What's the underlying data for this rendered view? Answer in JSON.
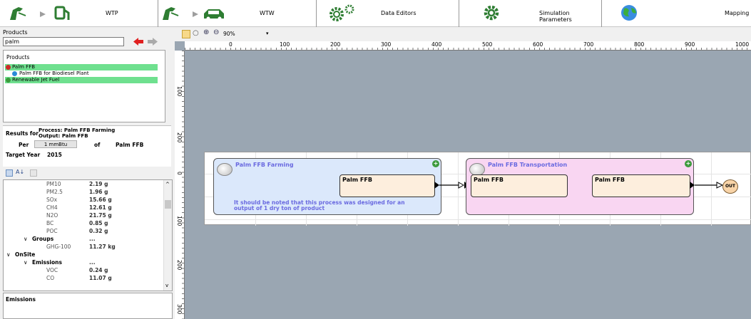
{
  "toolbar": {
    "items": [
      {
        "label": "WTP",
        "icon": "pump-to-fuel-icon"
      },
      {
        "label": "WTW",
        "icon": "pump-to-car-icon"
      },
      {
        "label": "Data Editors",
        "icon": "gears-icon"
      },
      {
        "label": "Simulation Parameters",
        "icon": "gear-icon"
      },
      {
        "label": "Mapping",
        "icon": "globe-icon"
      }
    ]
  },
  "products_panel": {
    "header": "Products",
    "search_value": "palm",
    "tree_header": "Products",
    "tree": [
      {
        "label": "Palm FFB",
        "highlight": true
      },
      {
        "label": "Palm FFB for Biodiesel Plant",
        "highlight": false
      },
      {
        "label": "Renewable Jet Fuel",
        "highlight": true
      }
    ]
  },
  "results": {
    "results_for_label": "Results for",
    "process": "Process: Palm FFB Farming",
    "output": "Output: Palm FFB",
    "per_label": "Per",
    "per_value": "1 mmBtu",
    "of_label": "of",
    "of_value": "Palm FFB",
    "target_year_label": "Target Year",
    "target_year": "2015",
    "rows": [
      {
        "name": "PM10",
        "value": "2.19 g",
        "level": 2
      },
      {
        "name": "PM2.5",
        "value": "1.96 g",
        "level": 2
      },
      {
        "name": "SOx",
        "value": "15.66 g",
        "level": 2
      },
      {
        "name": "CH4",
        "value": "12.61 g",
        "level": 2
      },
      {
        "name": "N2O",
        "value": "21.75 g",
        "level": 2
      },
      {
        "name": "BC",
        "value": "0.85 g",
        "level": 2
      },
      {
        "name": "POC",
        "value": "0.32 g",
        "level": 2
      },
      {
        "name": "Groups",
        "value": "...",
        "level": 1,
        "expander": "∨"
      },
      {
        "name": "GHG-100",
        "value": "11.27 kg",
        "level": 2
      },
      {
        "name": "OnSite",
        "value": "",
        "level": 0,
        "expander": "∨"
      },
      {
        "name": "Emissions",
        "value": "...",
        "level": 1,
        "expander": "∨"
      },
      {
        "name": "VOC",
        "value": "0.24 g",
        "level": 2
      },
      {
        "name": "CO",
        "value": "11.07 g",
        "level": 2
      }
    ],
    "description_title": "Emissions"
  },
  "canvas": {
    "zoom": "90%",
    "ruler_top": [
      "0",
      "100",
      "200",
      "300",
      "400",
      "500",
      "600",
      "700",
      "800",
      "900",
      "1000"
    ],
    "ruler_left": [
      "100",
      "200",
      "0",
      "100",
      "200",
      "300"
    ],
    "process1": {
      "title": "Palm FFB Farming",
      "output": "Palm FFB",
      "note": "It should be noted that this process was designed for an output of 1 dry ton of product"
    },
    "process2": {
      "title": "Palm FFB Transportation",
      "input": "Palm FFB",
      "output": "Palm FFB"
    },
    "out_label": "OUT"
  },
  "colors": {
    "process1_fill": "#dbe8fb",
    "process2_fill": "#f9d6f2",
    "title_text": "#6a6ae0",
    "highlight": "#6fe08f",
    "canvas_bg": "#9aa6b2"
  }
}
